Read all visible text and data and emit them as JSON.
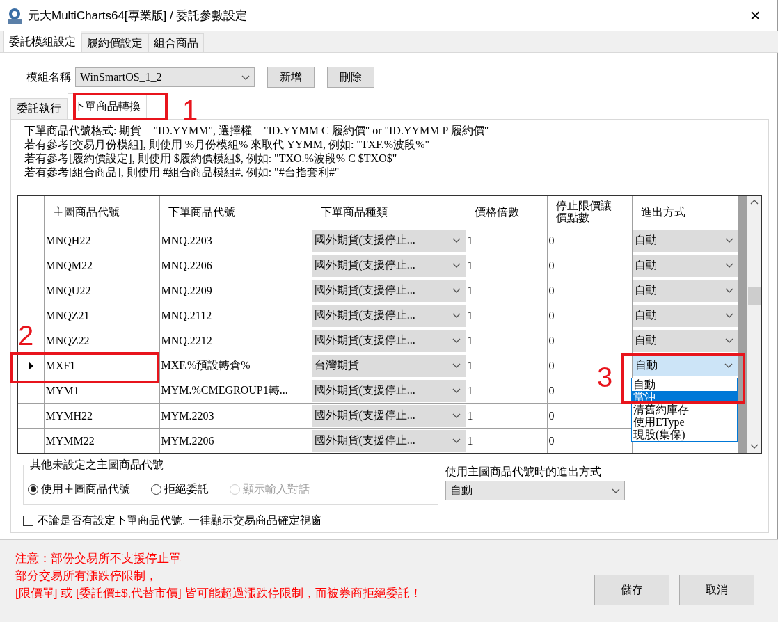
{
  "window": {
    "title": "元大MultiCharts64[專業版] / 委託參數設定",
    "close": "×"
  },
  "top_tabs": [
    {
      "label": "委託模組設定",
      "selected": true
    },
    {
      "label": "履約價設定",
      "selected": false
    },
    {
      "label": "組合商品",
      "selected": false
    }
  ],
  "module": {
    "label": "模組名稱",
    "value": "WinSmartOS_1_2",
    "buttons": [
      "新增",
      "刪除"
    ]
  },
  "inner_tabs": [
    {
      "label": "委託執行",
      "selected": false
    },
    {
      "label": "下單商品轉換",
      "selected": true
    }
  ],
  "description": [
    "下單商品代號格式: 期貨 = \"ID.YYMM\", 選擇權 = \"ID.YYMM C 履約價\" or \"ID.YYMM P 履約價\"",
    "若有參考[交易月份模組], 則使用  %月份模組% 來取代 YYMM, 例如: \"TXF.%波段%\"",
    "若有參考[履約價設定], 則使用 $履約價模組$, 例如: \"TXO.%波段% C $TXO$\"",
    "若有參考[組合商品], 則使用 #組合商品模組#, 例如: \"#台指套利#\""
  ],
  "table": {
    "columns": [
      "主圖商品代號",
      "下單商品代號",
      "下單商品種類",
      "價格倍數",
      "停止限價讓價點數",
      "進出方式"
    ],
    "rows": [
      {
        "current": false,
        "symbol": "MNQH22",
        "order_symbol": "MNQ.2203",
        "type": "國外期貨(支援停止...",
        "multiplier": "1",
        "stop_points": "0",
        "exit": "自動"
      },
      {
        "current": false,
        "symbol": "MNQM22",
        "order_symbol": "MNQ.2206",
        "type": "國外期貨(支援停止...",
        "multiplier": "1",
        "stop_points": "0",
        "exit": "自動"
      },
      {
        "current": false,
        "symbol": "MNQU22",
        "order_symbol": "MNQ.2209",
        "type": "國外期貨(支援停止...",
        "multiplier": "1",
        "stop_points": "0",
        "exit": "自動"
      },
      {
        "current": false,
        "symbol": "MNQZ21",
        "order_symbol": "MNQ.2112",
        "type": "國外期貨(支援停止...",
        "multiplier": "1",
        "stop_points": "0",
        "exit": "自動"
      },
      {
        "current": false,
        "symbol": "MNQZ22",
        "order_symbol": "MNQ.2212",
        "type": "國外期貨(支援停止...",
        "multiplier": "1",
        "stop_points": "0",
        "exit": "自動"
      },
      {
        "current": true,
        "symbol": "MXF1",
        "order_symbol": "MXF.%預設轉倉%",
        "type": "台灣期貨",
        "multiplier": "1",
        "stop_points": "0",
        "exit": "自動",
        "editing": true
      },
      {
        "current": false,
        "symbol": "MYM1",
        "order_symbol": "MYM.%CMEGROUP1轉...",
        "type": "國外期貨(支援停止...",
        "multiplier": "1",
        "stop_points": "0"
      },
      {
        "current": false,
        "symbol": "MYMH22",
        "order_symbol": "MYM.2203",
        "type": "國外期貨(支援停止...",
        "multiplier": "1",
        "stop_points": "0"
      },
      {
        "current": false,
        "symbol": "MYMM22",
        "order_symbol": "MYM.2206",
        "type": "國外期貨(支援停止...",
        "multiplier": "1",
        "stop_points": "0"
      }
    ],
    "dropdown": [
      {
        "label": "自動",
        "selected": false
      },
      {
        "label": "當沖",
        "selected": true
      },
      {
        "label": "清舊約庫存",
        "selected": false
      },
      {
        "label": "使用EType",
        "selected": false
      },
      {
        "label": "現股(集保)",
        "selected": false
      }
    ]
  },
  "fallback": {
    "legend": "其他未設定之主圖商品代號",
    "radios": [
      {
        "label": "使用主圖商品代號",
        "selected": true,
        "disabled": false
      },
      {
        "label": "拒絕委託",
        "selected": false,
        "disabled": false
      },
      {
        "label": "顯示輸入對話",
        "selected": false,
        "disabled": true
      }
    ],
    "exit_label": "使用主圖商品代號時的進出方式",
    "exit_value": "自動"
  },
  "always_confirm": {
    "label": "不論是否有設定下單商品代號, 一律顯示交易商品確定視窗",
    "checked": false
  },
  "notes": [
    "注意：部份交易所不支援停止單",
    "部分交易所有漲跌停限制，",
    "[限價單] 或 [委託價±$,代替市價] 皆可能超過漲跌停限制，而被券商拒絕委託！"
  ],
  "buttons": [
    "儲存",
    "取消"
  ],
  "annotations": [
    {
      "label": "1"
    },
    {
      "label": "2"
    },
    {
      "label": "3"
    }
  ]
}
